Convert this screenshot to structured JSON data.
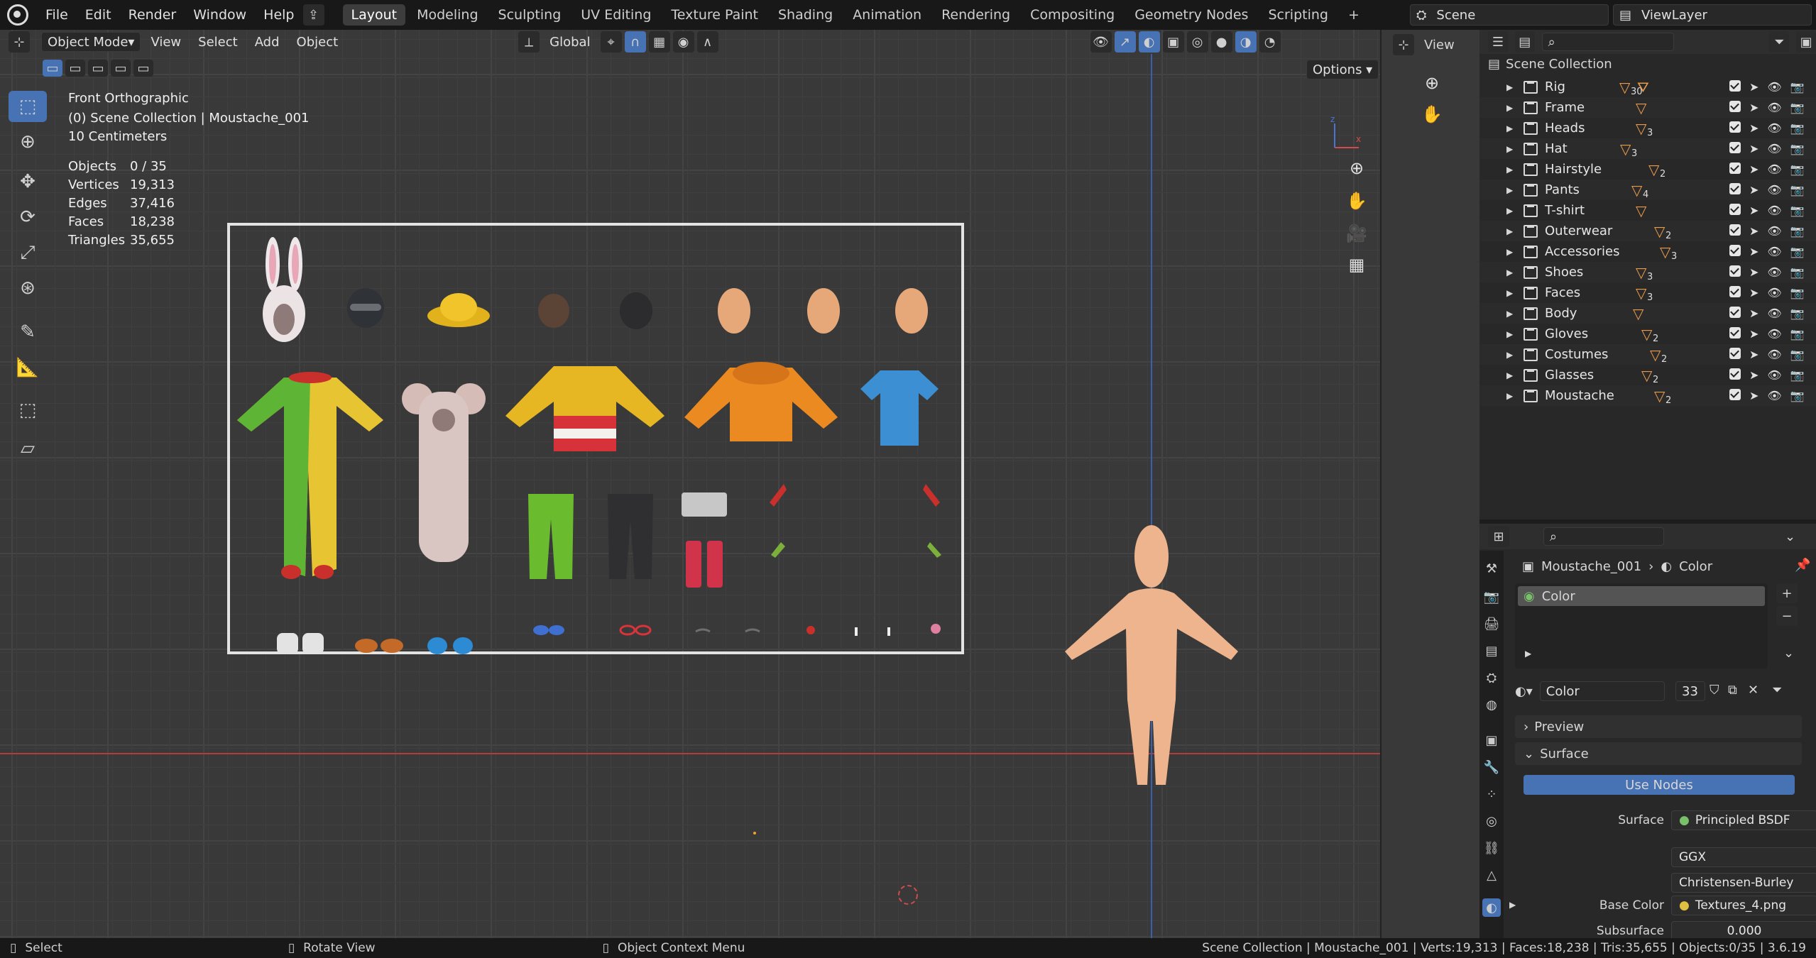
{
  "menus": [
    "File",
    "Edit",
    "Render",
    "Window",
    "Help"
  ],
  "workspaces": [
    "Layout",
    "Modeling",
    "Sculpting",
    "UV Editing",
    "Texture Paint",
    "Shading",
    "Animation",
    "Rendering",
    "Compositing",
    "Geometry Nodes",
    "Scripting"
  ],
  "active_workspace": "Layout",
  "scene": "Scene",
  "view_layer": "ViewLayer",
  "viewport": {
    "mode": "Object Mode",
    "menus": [
      "View",
      "Select",
      "Add",
      "Object"
    ],
    "orientation": "Global",
    "options": "Options",
    "view_name": "Front Orthographic",
    "collection_info": "(0) Scene Collection | Moustache_001",
    "scale": "10 Centimeters",
    "stats": [
      {
        "label": "Objects",
        "value": "0 / 35"
      },
      {
        "label": "Vertices",
        "value": "19,313"
      },
      {
        "label": "Edges",
        "value": "37,416"
      },
      {
        "label": "Faces",
        "value": "18,238"
      },
      {
        "label": "Triangles",
        "value": "35,655"
      }
    ],
    "axis_x": "x",
    "axis_z": "z"
  },
  "side_view": {
    "label": "View"
  },
  "outliner": {
    "root": "Scene Collection",
    "items": [
      {
        "name": "Rig",
        "badge": "30",
        "extra": "rig"
      },
      {
        "name": "Frame",
        "badge": ""
      },
      {
        "name": "Heads",
        "badge": "3"
      },
      {
        "name": "Hat",
        "badge": "3"
      },
      {
        "name": "Hairstyle",
        "badge": "2"
      },
      {
        "name": "Pants",
        "badge": "4"
      },
      {
        "name": "T-shirt",
        "badge": ""
      },
      {
        "name": "Outerwear",
        "badge": "2"
      },
      {
        "name": "Accessories",
        "badge": "3"
      },
      {
        "name": "Shoes",
        "badge": "3"
      },
      {
        "name": "Faces",
        "badge": "3"
      },
      {
        "name": "Body",
        "badge": ""
      },
      {
        "name": "Gloves",
        "badge": "2"
      },
      {
        "name": "Costumes",
        "badge": "2"
      },
      {
        "name": "Glasses",
        "badge": "2"
      },
      {
        "name": "Moustache",
        "badge": "2"
      }
    ]
  },
  "properties": {
    "object": "Moustache_001",
    "material": "Color",
    "slot": "Color",
    "mat_name": "Color",
    "users": "33",
    "panels": {
      "preview": "Preview",
      "surface": "Surface"
    },
    "use_nodes": "Use Nodes",
    "surface_label": "Surface",
    "surface_value": "Principled BSDF",
    "dist": "GGX",
    "subsurface_method": "Christensen-Burley",
    "base_color_label": "Base Color",
    "base_color_value": "Textures_4.png",
    "subsurface_label": "Subsurface",
    "subsurface_value": "0.000"
  },
  "status": {
    "select": "Select",
    "rotate": "Rotate View",
    "context": "Object Context Menu",
    "info": "Scene Collection | Moustache_001 | Verts:19,313 | Faces:18,238 | Tris:35,655 | Objects:0/35 | 3.6.19"
  },
  "colors": {
    "accent": "#4772b3",
    "orange": "#e99a4a",
    "red_axis": "#b33c3c",
    "blue_axis": "#3b5fa8"
  }
}
